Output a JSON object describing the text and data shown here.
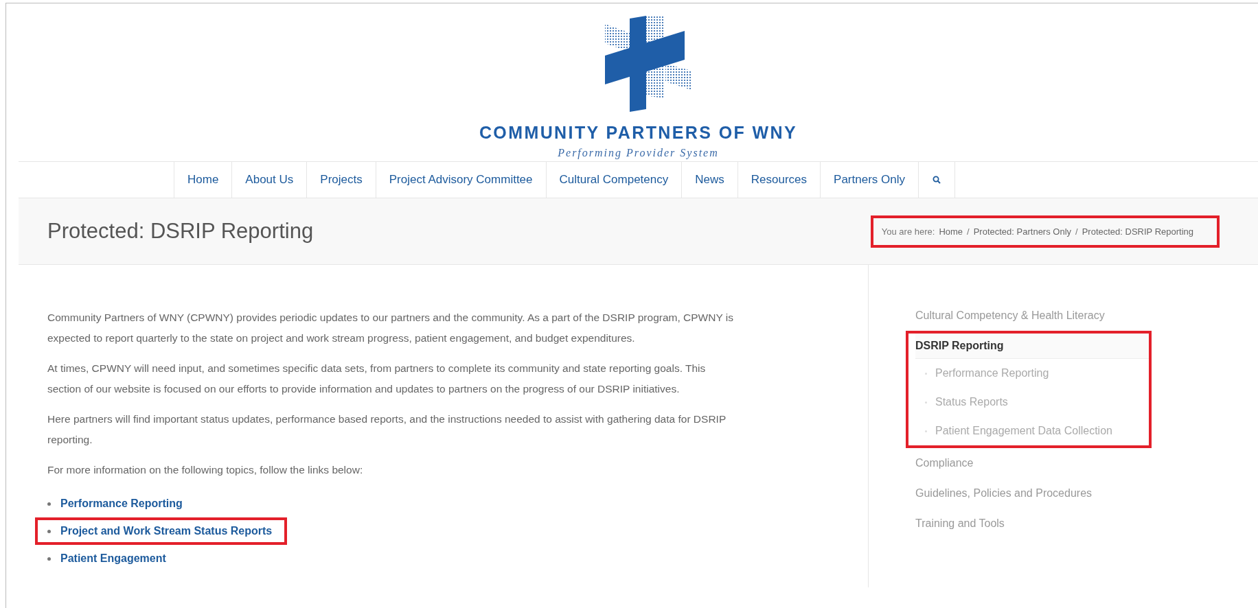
{
  "header": {
    "org_name": "COMMUNITY PARTNERS OF WNY",
    "tagline": "Performing Provider System"
  },
  "nav": {
    "items": [
      {
        "label": "Home"
      },
      {
        "label": "About Us"
      },
      {
        "label": "Projects"
      },
      {
        "label": "Project Advisory Committee"
      },
      {
        "label": "Cultural Competency"
      },
      {
        "label": "News"
      },
      {
        "label": "Resources"
      },
      {
        "label": "Partners Only"
      }
    ]
  },
  "page_title": "Protected: DSRIP Reporting",
  "breadcrumb": {
    "prefix": "You are here:",
    "separator": "/",
    "items": [
      "Home",
      "Protected: Partners Only",
      "Protected: DSRIP Reporting"
    ],
    "highlighted": true
  },
  "content": {
    "paragraphs": [
      "Community Partners of WNY (CPWNY) provides periodic updates to our partners and the community. As a part of the DSRIP program, CPWNY is expected to report quarterly to the state on project and work stream progress, patient engagement, and budget expenditures.",
      "At times, CPWNY will need input, and sometimes specific data sets, from partners to complete its community and state reporting goals. This section of our website is focused on our efforts to provide information and updates to partners on the progress of our DSRIP initiatives.",
      "Here partners will find important status updates, performance based reports, and the instructions needed to assist with gathering data for DSRIP reporting.",
      "For more information on the following topics, follow the links below:"
    ],
    "links": [
      {
        "label": "Performance Reporting",
        "highlighted": false
      },
      {
        "label": "Project and Work Stream Status Reports",
        "highlighted": true
      },
      {
        "label": "Patient Engagement",
        "highlighted": false
      }
    ]
  },
  "sidebar": {
    "items": [
      {
        "label": "Cultural Competency & Health Literacy",
        "selected": false,
        "highlighted": false
      },
      {
        "label": "DSRIP Reporting",
        "selected": true,
        "highlighted": true,
        "children": [
          {
            "label": "Performance Reporting"
          },
          {
            "label": "Status Reports"
          },
          {
            "label": "Patient Engagement Data Collection"
          }
        ]
      },
      {
        "label": "Compliance",
        "selected": false,
        "highlighted": false
      },
      {
        "label": "Guidelines, Policies and Procedures",
        "selected": false,
        "highlighted": false
      },
      {
        "label": "Training and Tools",
        "selected": false,
        "highlighted": false
      }
    ]
  }
}
